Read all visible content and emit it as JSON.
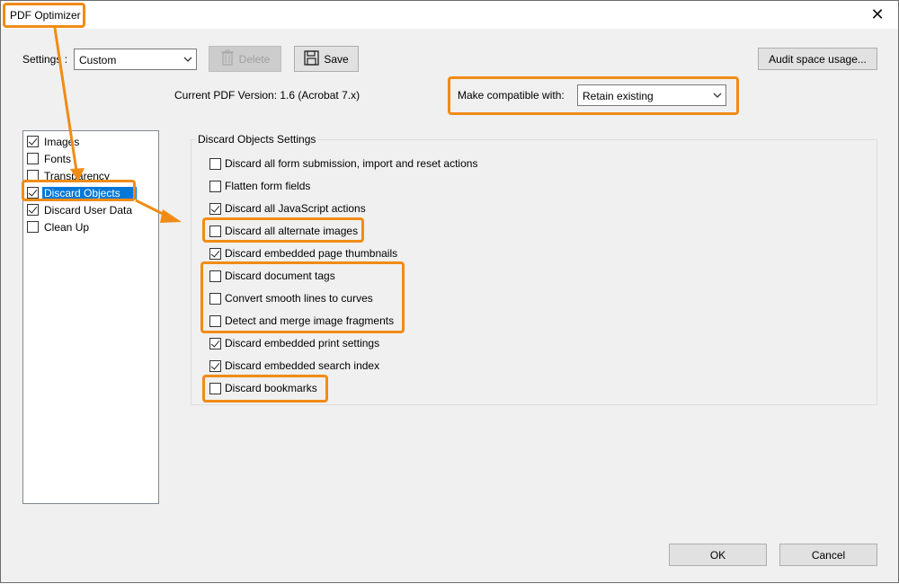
{
  "window": {
    "title": "PDF Optimizer",
    "close_glyph": "✕"
  },
  "settings": {
    "label": "Settings :",
    "selected": "Custom",
    "delete_label": "Delete",
    "save_label": "Save",
    "audit_label": "Audit space usage..."
  },
  "version": {
    "text": "Current PDF Version: 1.6 (Acrobat 7.x)",
    "compat_label": "Make compatible with:",
    "compat_selected": "Retain existing"
  },
  "panels": [
    {
      "label": "Images",
      "checked": true,
      "selected": false
    },
    {
      "label": "Fonts",
      "checked": false,
      "selected": false
    },
    {
      "label": "Transparency",
      "checked": false,
      "selected": false
    },
    {
      "label": "Discard Objects",
      "checked": true,
      "selected": true
    },
    {
      "label": "Discard User Data",
      "checked": true,
      "selected": false
    },
    {
      "label": "Clean Up",
      "checked": false,
      "selected": false
    }
  ],
  "discard": {
    "title": "Discard Objects Settings",
    "options": [
      {
        "label": "Discard all form submission, import and reset actions",
        "checked": false
      },
      {
        "label": "Flatten form fields",
        "checked": false
      },
      {
        "label": "Discard all JavaScript actions",
        "checked": true
      },
      {
        "label": "Discard all alternate images",
        "checked": false
      },
      {
        "label": "Discard embedded page thumbnails",
        "checked": true
      },
      {
        "label": "Discard document tags",
        "checked": false
      },
      {
        "label": "Convert smooth lines to curves",
        "checked": false
      },
      {
        "label": "Detect and merge image fragments",
        "checked": false
      },
      {
        "label": "Discard embedded print settings",
        "checked": true
      },
      {
        "label": "Discard embedded search index",
        "checked": true
      },
      {
        "label": "Discard bookmarks",
        "checked": false
      }
    ]
  },
  "footer": {
    "ok_label": "OK",
    "cancel_label": "Cancel"
  },
  "colors": {
    "highlight": "#f08c16",
    "selection": "#0078d7"
  }
}
